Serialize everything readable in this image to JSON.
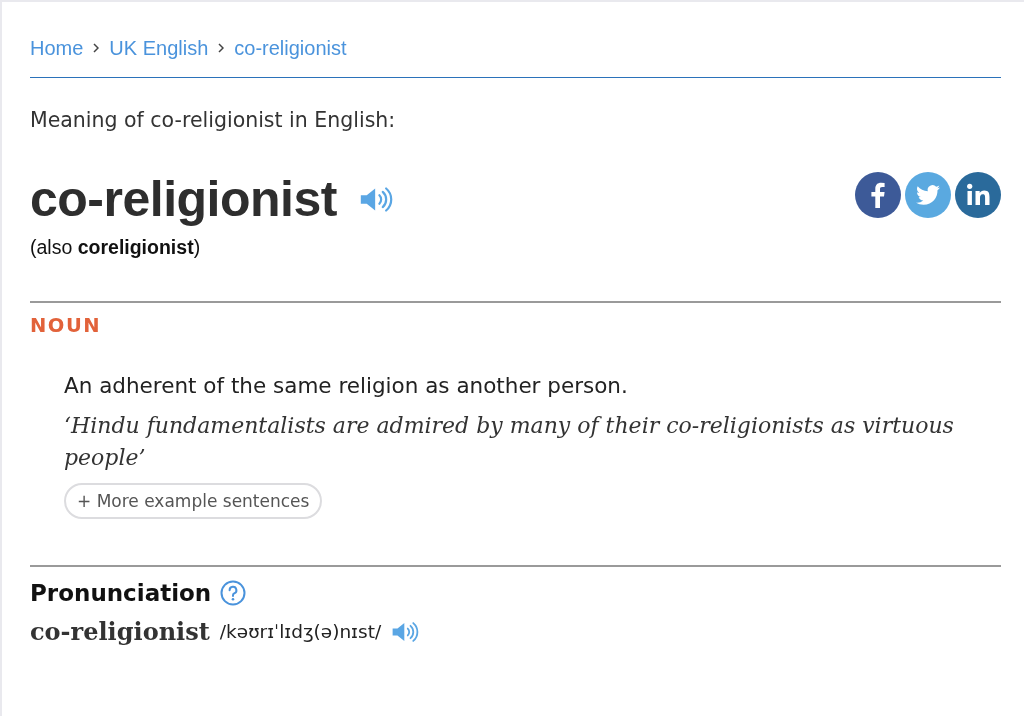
{
  "breadcrumb": [
    {
      "label": "Home"
    },
    {
      "label": "UK English"
    },
    {
      "label": "co-religionist"
    }
  ],
  "meaning_heading": "Meaning of co-religionist in English:",
  "headword": {
    "text": "co-religionist",
    "variant": "(also **coreligionist**)"
  },
  "share": [
    {
      "kind": "facebook"
    },
    {
      "kind": "twitter"
    },
    {
      "kind": "linkedin"
    }
  ],
  "entries": [
    {
      "part_of_speech": "NOUN",
      "senses": [
        {
          "definition": "An adherent of the same religion as another person.",
          "example": "‘Hindu fundamentalists are admired by many of their co-religionists as virtuous people’",
          "more_button": "+ More example sentences"
        }
      ]
    }
  ],
  "pronunciation": {
    "heading": "Pronunciation",
    "items": [
      {
        "word": "co-religionist",
        "ipa": "/kəʊrɪˈlɪdʒ(ə)nɪst/"
      }
    ]
  }
}
